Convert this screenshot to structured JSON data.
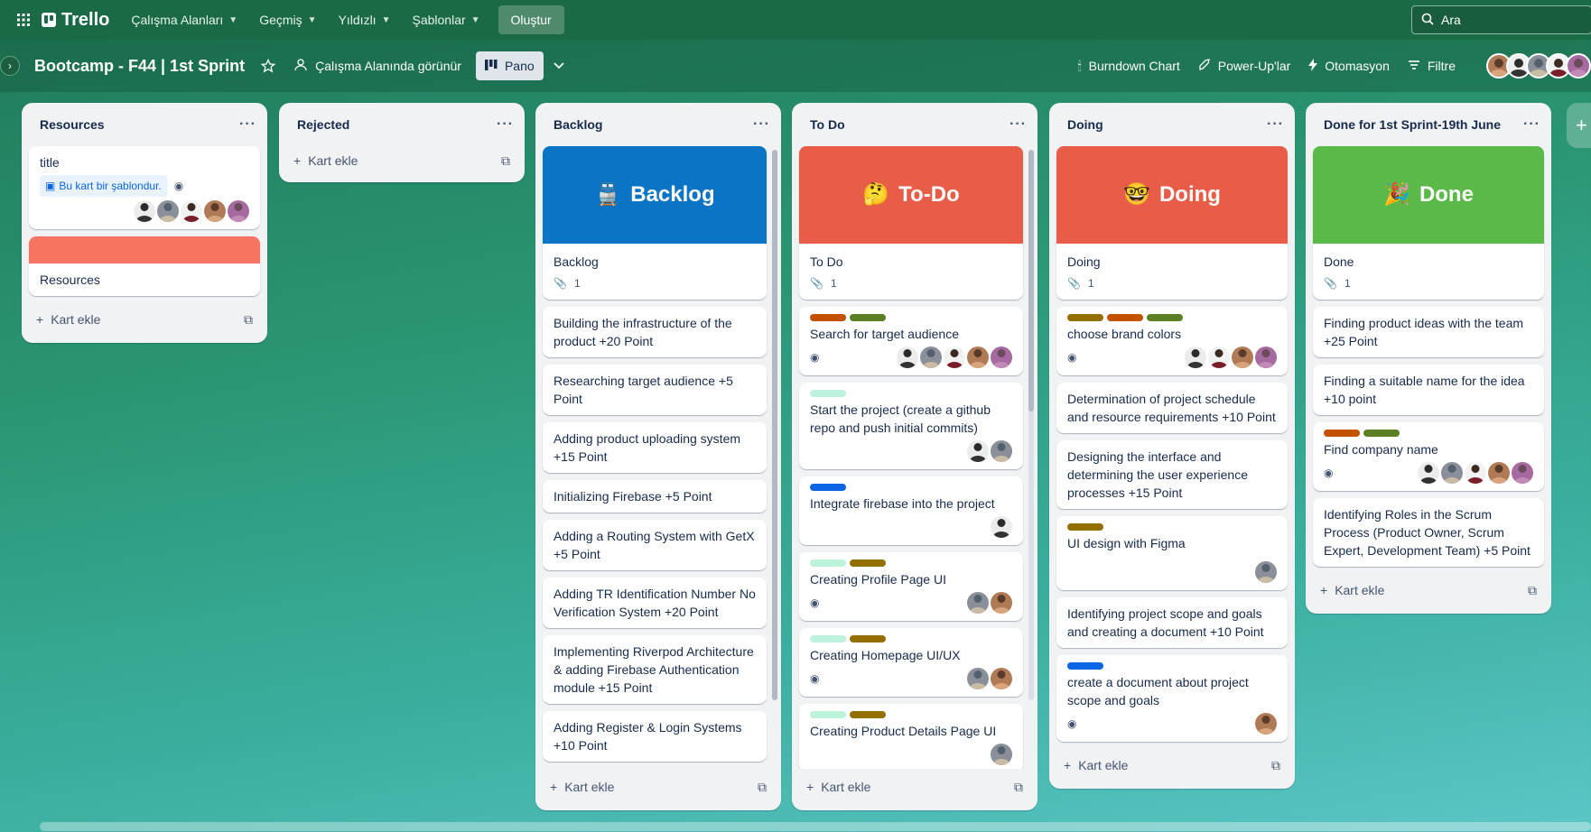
{
  "topbar": {
    "logo": "Trello",
    "menus": [
      "Çalışma Alanları",
      "Geçmiş",
      "Yıldızlı",
      "Şablonlar"
    ],
    "create": "Oluştur",
    "search_placeholder": "Ara"
  },
  "boardbar": {
    "title": "Bootcamp - F44 | 1st Sprint",
    "visibility": "Çalışma Alanında görünür",
    "view": "Pano",
    "actions": [
      "Burndown Chart",
      "Power-Up'lar",
      "Otomasyon",
      "Filtre"
    ]
  },
  "add_card": "Kart ekle",
  "lists": [
    {
      "title": "Resources",
      "cards": [
        {
          "text": "title",
          "template_badge": "Bu kart bir şablondur."
        },
        {
          "text": "Resources"
        }
      ]
    },
    {
      "title": "Rejected",
      "cards": []
    },
    {
      "title": "Backlog",
      "cover_title": "Backlog",
      "cover_emoji": "🚆",
      "cards": [
        {
          "text": "Backlog",
          "attachments": "1"
        },
        {
          "text": "Building the infrastructure of the product +20 Point"
        },
        {
          "text": "Researching target audience +5 Point"
        },
        {
          "text": "Adding product uploading system +15 Point"
        },
        {
          "text": "Initializing Firebase +5 Point"
        },
        {
          "text": "Adding a Routing System with GetX +5 Point"
        },
        {
          "text": "Adding TR Identification Number No Verification System +20 Point"
        },
        {
          "text": "Implementing Riverpod Architecture & adding Firebase Authentication module +15 Point"
        },
        {
          "text": "Adding Register & Login Systems +10 Point"
        }
      ]
    },
    {
      "title": "To Do",
      "cover_title": "To-Do",
      "cover_emoji": "🤔",
      "cards": [
        {
          "text": "To Do",
          "attachments": "1"
        },
        {
          "text": "Search for target audience"
        },
        {
          "text": "Start the project (create a github repo and push initial commits)"
        },
        {
          "text": "Integrate firebase into the project"
        },
        {
          "text": "Creating Profile Page UI"
        },
        {
          "text": "Creating Homepage UI/UX"
        },
        {
          "text": "Creating Product Details Page UI"
        }
      ]
    },
    {
      "title": "Doing",
      "cover_title": "Doing",
      "cover_emoji": "🤓",
      "cards": [
        {
          "text": "Doing",
          "attachments": "1"
        },
        {
          "text": "choose brand colors"
        },
        {
          "text": "Determination of project schedule and resource requirements +10 Point"
        },
        {
          "text": "Designing the interface and determining the user experience processes +15 Point"
        },
        {
          "text": "UI design with Figma"
        },
        {
          "text": "Identifying project scope and goals and creating a document +10 Point"
        },
        {
          "text": "create a document about project scope and goals"
        }
      ]
    },
    {
      "title": "Done for 1st Sprint-19th June",
      "cover_title": "Done",
      "cover_emoji": "🎉",
      "cards": [
        {
          "text": "Done",
          "attachments": "1"
        },
        {
          "text": "Finding product ideas with the team +25 Point"
        },
        {
          "text": "Finding a suitable name for the idea +10 point"
        },
        {
          "text": "Find company name"
        },
        {
          "text": "Identifying Roles in the Scrum Process (Product Owner, Scrum Expert, Development Team) +5 Point"
        }
      ]
    }
  ],
  "colors": {
    "backlog_cover": "#0c74c4",
    "todo_cover": "#e85d48",
    "doing_cover": "#e85d48",
    "done_cover": "#5bb94a",
    "resources_cover": "#f87462",
    "label_orange": "#c25100",
    "label_green": "#5b7f24",
    "label_yellow": "#946f00",
    "label_mint": "#bdf2dc",
    "label_blue": "#0c66e4"
  }
}
